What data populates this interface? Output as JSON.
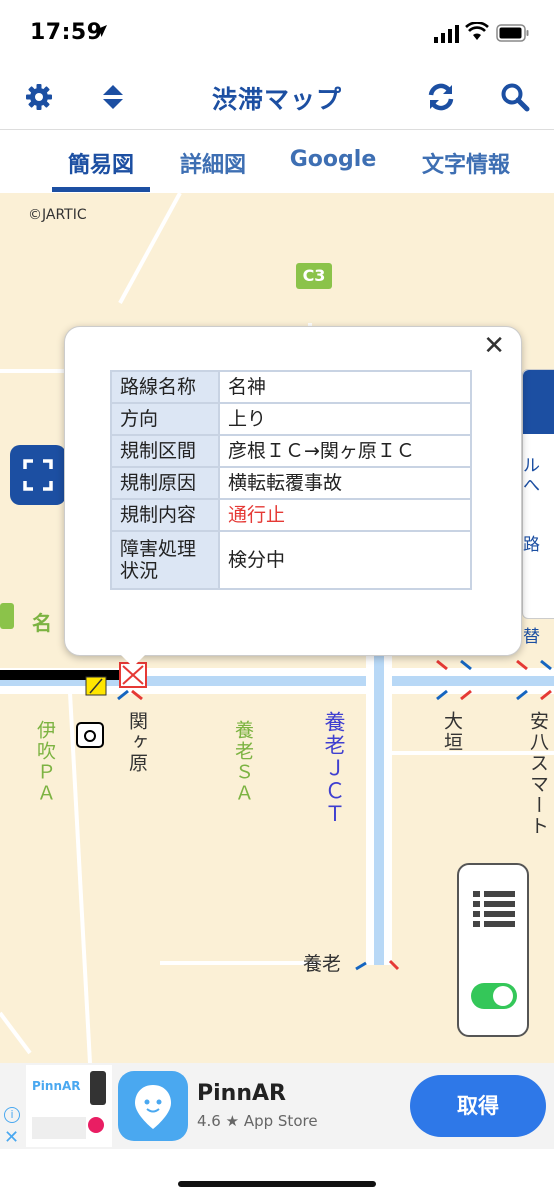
{
  "status_bar": {
    "time": "17:59"
  },
  "navbar": {
    "title": "渋滞マップ"
  },
  "tabs": [
    {
      "label": "簡易図",
      "active": true
    },
    {
      "label": "詳細図",
      "active": false
    },
    {
      "label": "Google",
      "active": false
    },
    {
      "label": "文字情報",
      "active": false
    }
  ],
  "map": {
    "copyright": "©JARTIC",
    "route_badge": "C3",
    "labels": {
      "ibuki_pa": "伊吹ＰＡ",
      "sekigahara": "関ヶ原",
      "yoro_sa": "養老ＳＡ",
      "yoro_jct": "養老ＪＣＴ",
      "ogaki": "大垣",
      "yasu_smart": "安八スマート",
      "yoro": "養老",
      "mei": "名"
    },
    "side_panel": {
      "items": [
        "ル\nへ",
        "路",
        "替"
      ]
    }
  },
  "popup": {
    "rows": [
      {
        "key": "路線名称",
        "value": "名神",
        "color": "#222222"
      },
      {
        "key": "方向",
        "value": "上り",
        "color": "#222222"
      },
      {
        "key": "規制区間",
        "value": "彦根ＩＣ→関ヶ原ＩＣ",
        "color": "#222222"
      },
      {
        "key": "規制原因",
        "value": "横転転覆事故",
        "color": "#222222"
      },
      {
        "key": "規制内容",
        "value": "通行止",
        "color": "#e53935"
      },
      {
        "key": "障害処理状況",
        "value": "検分中",
        "color": "#222222"
      }
    ]
  },
  "ad": {
    "app_name": "PinnAR",
    "rating": "4.6 ★ App Store",
    "get_label": "取得",
    "thumb_brand": "PinnAR"
  },
  "colors": {
    "brand_blue": "#1c4fa2",
    "map_bg": "#fbf0d6",
    "accent_green": "#34c759",
    "alert_red": "#e53935"
  }
}
